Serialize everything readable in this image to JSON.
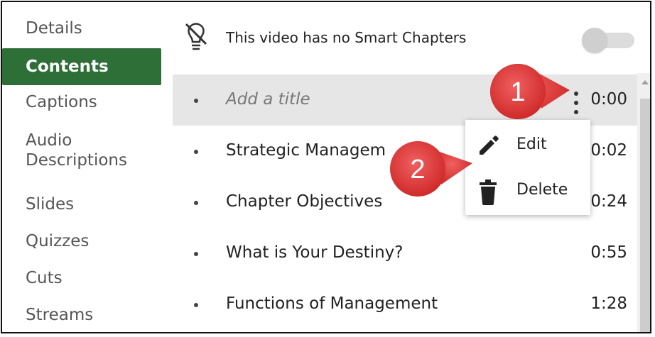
{
  "sidebar": {
    "items": [
      {
        "label": "Details",
        "active": false
      },
      {
        "label": "Contents",
        "active": true
      },
      {
        "label": "Captions",
        "active": false
      },
      {
        "label": "Audio",
        "label2": "Descriptions",
        "active": false
      },
      {
        "label": "Slides",
        "active": false
      },
      {
        "label": "Quizzes",
        "active": false
      },
      {
        "label": "Cuts",
        "active": false
      },
      {
        "label": "Streams",
        "active": false
      }
    ]
  },
  "header": {
    "icon": "lightbulb-off-icon",
    "text": "This video has no Smart Chapters",
    "toggle_on": false
  },
  "chapters": [
    {
      "title": "Add a title",
      "time": "0:00",
      "placeholder": true
    },
    {
      "title": "Strategic Managem",
      "time": "0:02"
    },
    {
      "title": "Chapter Objectives",
      "time": "0:24"
    },
    {
      "title": "What is Your Destiny?",
      "time": "0:55"
    },
    {
      "title": "Functions of Management",
      "time": "1:28"
    }
  ],
  "menu": {
    "items": [
      {
        "label": "Edit",
        "icon": "pencil-icon"
      },
      {
        "label": "Delete",
        "icon": "trash-icon"
      }
    ]
  },
  "callouts": [
    {
      "number": "1"
    },
    {
      "number": "2"
    }
  ],
  "colors": {
    "active_nav": "#2e6f38",
    "callout_red": "#e03b3b",
    "selected_row": "#e6e6e6"
  }
}
